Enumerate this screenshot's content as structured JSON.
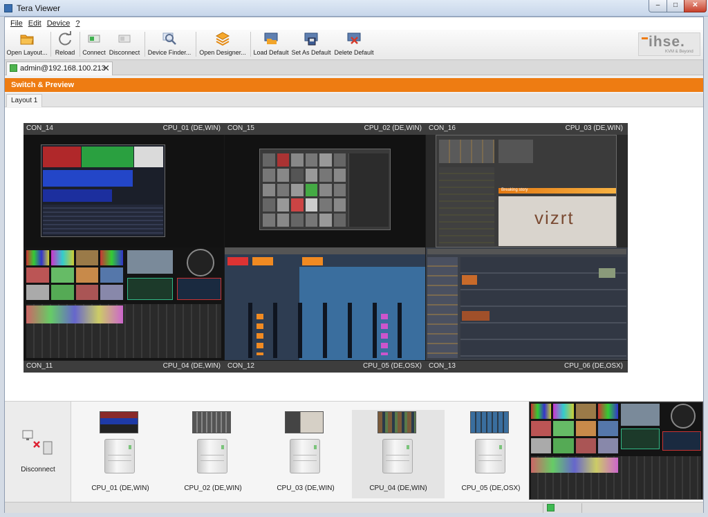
{
  "window": {
    "title": "Tera Viewer",
    "min": "–",
    "max": "□",
    "close": "✕"
  },
  "menu": [
    "File",
    "Edit",
    "Device",
    "?"
  ],
  "toolbar": {
    "open_layout": "Open Layout...",
    "reload": "Reload",
    "connect": "Connect",
    "disconnect": "Disconnect",
    "device_finder": "Device Finder...",
    "open_designer": "Open Designer...",
    "load_default": "Load Default",
    "set_as_default": "Set As Default",
    "delete_default": "Delete Default"
  },
  "logo": {
    "text": "ihse.",
    "tagline": "KVM & Beyond"
  },
  "session": {
    "label": "admin@192.168.100.213",
    "close": "✕"
  },
  "section": {
    "title": "Switch & Preview"
  },
  "layout_tab": "Layout 1",
  "preview": {
    "top_labels": [
      {
        "con": "CON_14",
        "cpu": "CPU_01 (DE,WIN)"
      },
      {
        "con": "CON_15",
        "cpu": "CPU_02 (DE,WIN)"
      },
      {
        "con": "CON_16",
        "cpu": "CPU_03 (DE,WIN)"
      }
    ],
    "bottom_labels": [
      {
        "con": "CON_11",
        "cpu": "CPU_04 (DE,WIN)"
      },
      {
        "con": "CON_12",
        "cpu": "CPU_05 (DE,OSX)"
      },
      {
        "con": "CON_13",
        "cpu": "CPU_06 (DE,OSX)"
      }
    ],
    "vizrt_text": "vizrt",
    "breaking": "Breaking story"
  },
  "bottom": {
    "disconnect_label": "Disconnect",
    "cpus": [
      {
        "label": "CPU_01 (DE,WIN)"
      },
      {
        "label": "CPU_02 (DE,WIN)"
      },
      {
        "label": "CPU_03 (DE,WIN)"
      },
      {
        "label": "CPU_04 (DE,WIN)"
      },
      {
        "label": "CPU_05 (DE,OSX)"
      }
    ]
  },
  "colors": {
    "accent": "#ee7c12",
    "status_ok": "#3fba52"
  }
}
